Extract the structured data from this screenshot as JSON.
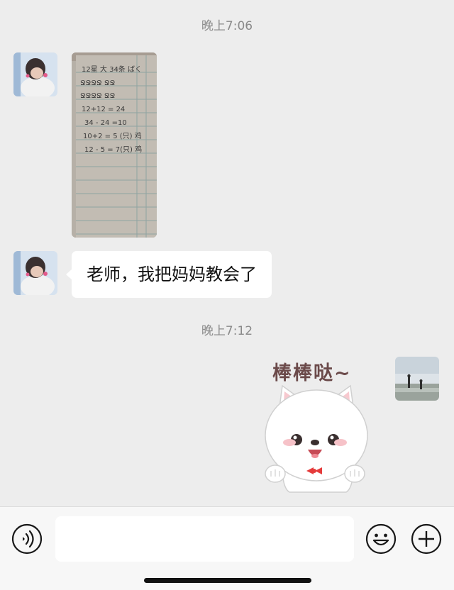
{
  "chat": {
    "timestamp_1": "晚上7:06",
    "timestamp_2": "晚上7:12",
    "received_text": "老师，我把妈妈教会了",
    "sticker_caption": "棒棒哒~",
    "photo_lines": [
      "12星 大 34条 ばく",
      "ՋՋՋՋ ՋՋ",
      "ՋՋՋՋ ՋՋ",
      "12+12 = 24",
      "34 - 24 =10",
      "10+2 = 5 (只) 鸡",
      "12 - 5 = 7(只) 鸡"
    ]
  },
  "input_bar": {
    "message_value": "",
    "voice_icon": "voice-icon",
    "emoji_icon": "emoji-icon",
    "more_icon": "plus-icon"
  },
  "colors": {
    "background": "#ededed",
    "bubble": "#ffffff",
    "input_bar": "#f7f7f7"
  }
}
